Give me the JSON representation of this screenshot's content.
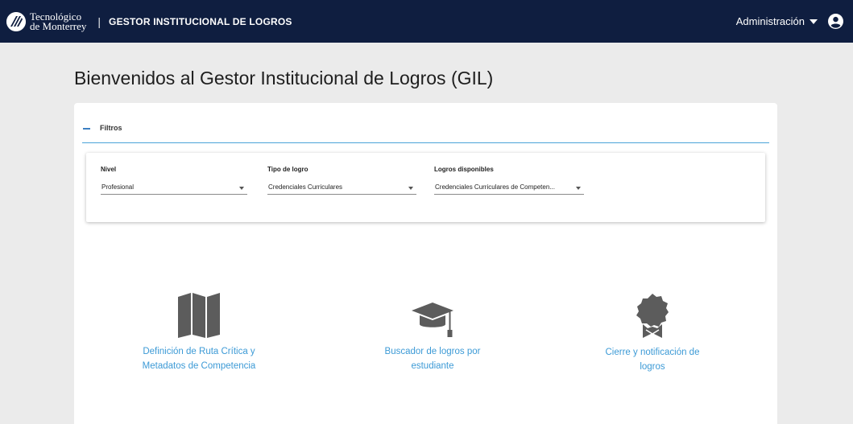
{
  "header": {
    "logo_line1": "Tecnológico",
    "logo_line2": "de Monterrey",
    "separator": "|",
    "app_title": "GESTOR INSTITUCIONAL DE LOGROS",
    "admin_menu": "Administración"
  },
  "page": {
    "title": "Bienvenidos al Gestor Institucional de Logros (GIL)"
  },
  "filters": {
    "title": "Filtros",
    "fields": [
      {
        "label": "Nivel",
        "value": "Profesional"
      },
      {
        "label": "Tipo de logro",
        "value": "Credenciales Curriculares"
      },
      {
        "label": "Logros disponibles",
        "value": "Credenciales Curriculares de Competen..."
      }
    ]
  },
  "tiles": [
    {
      "icon": "map-icon",
      "line1": "Definición de Ruta Crítica y",
      "line2": "Metadatos de Competencia"
    },
    {
      "icon": "graduation-cap-icon",
      "line1": "Buscador de logros por",
      "line2": "estudiante"
    },
    {
      "icon": "award-badge-icon",
      "line1": "Cierre y notificación de",
      "line2": "logros"
    }
  ],
  "colors": {
    "header_bg": "#0f1e40",
    "link": "#3c9ad6",
    "divider": "#4aa3d8",
    "icon_gray": "#5c5c5c"
  }
}
